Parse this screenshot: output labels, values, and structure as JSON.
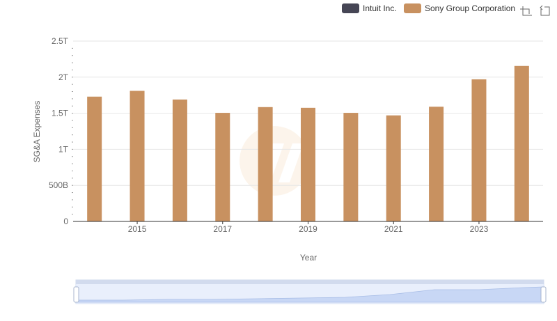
{
  "toolbox": {
    "zoom_icon": "data-zoom-icon",
    "restore_icon": "restore-icon"
  },
  "chart_data": {
    "type": "bar",
    "xlabel": "Year",
    "ylabel": "SG&A Expenses",
    "categories": [
      "2014",
      "2015",
      "2016",
      "2017",
      "2018",
      "2019",
      "2020",
      "2021",
      "2022",
      "2023",
      "2024"
    ],
    "x_tick_labels": [
      "2015",
      "2017",
      "2019",
      "2021",
      "2023"
    ],
    "y_tick_labels": [
      "0",
      "500B",
      "1T",
      "1.5T",
      "2T",
      "2.5T"
    ],
    "ylim": [
      0,
      2500000000000
    ],
    "grid": true,
    "legend_position": "top-right",
    "series": [
      {
        "name": "Intuit Inc.",
        "color": "#464655",
        "values": [
          null,
          null,
          null,
          null,
          null,
          null,
          null,
          null,
          null,
          null,
          null
        ]
      },
      {
        "name": "Sony Group Corporation",
        "color": "#c89160",
        "values": [
          1730000000000,
          1810000000000,
          1690000000000,
          1505000000000,
          1585000000000,
          1575000000000,
          1505000000000,
          1470000000000,
          1590000000000,
          1970000000000,
          2155000000000
        ]
      }
    ]
  }
}
